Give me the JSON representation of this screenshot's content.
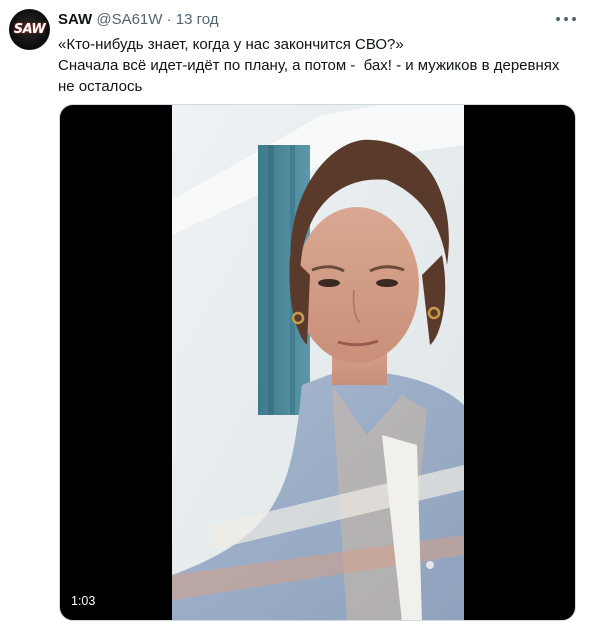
{
  "tweet": {
    "avatar_text": "SAW",
    "author_name": "SAW",
    "handle": "@SA61W",
    "separator": "·",
    "timestamp": "13 год",
    "text_lines": [
      "«Кто-нибудь знает, когда у нас закончится СВО?»",
      "Сначала всё идет-идёт по плану, а потом -  бах! - и мужиков в деревнях не осталось"
    ],
    "video": {
      "duration": "1:03"
    }
  }
}
